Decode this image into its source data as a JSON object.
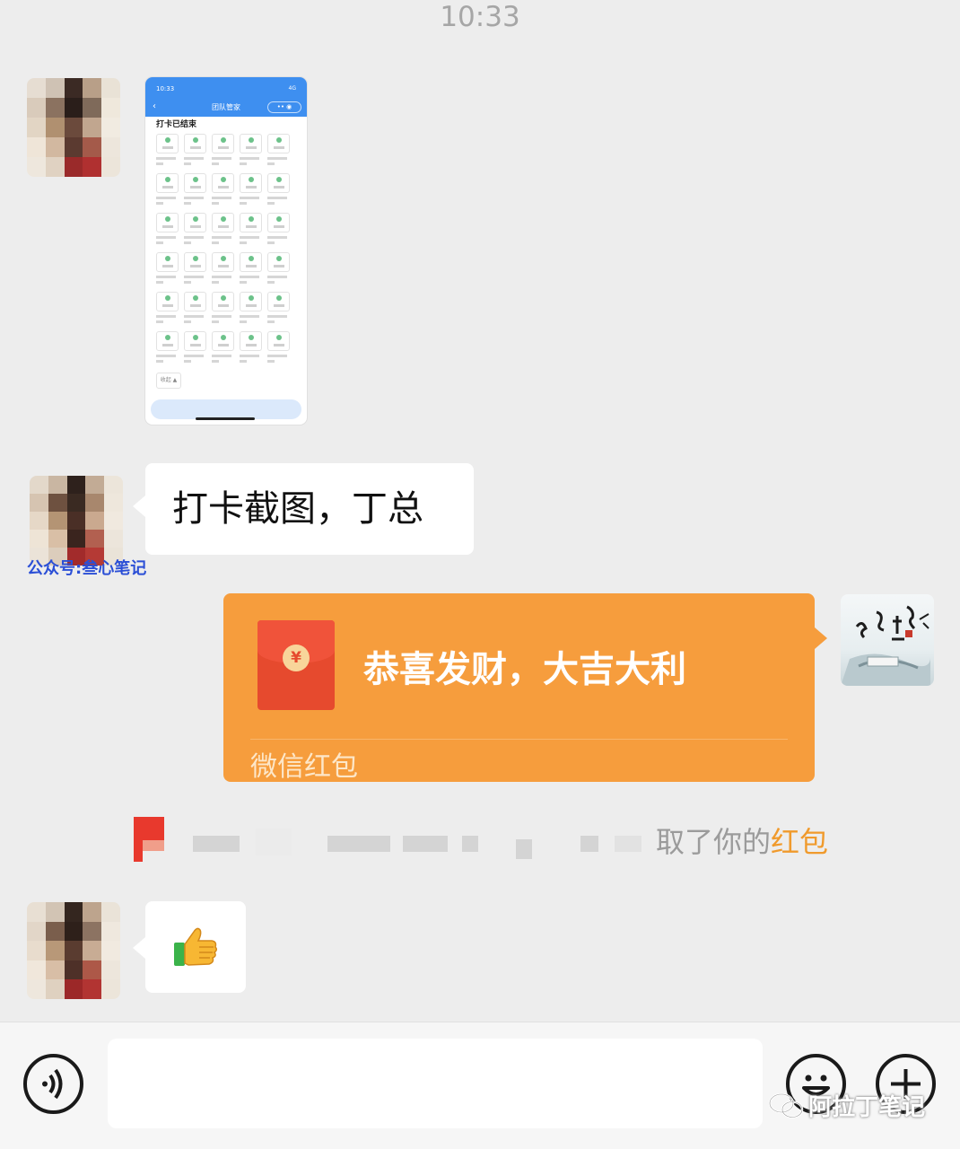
{
  "status": {
    "time": "10:33"
  },
  "chat": {
    "shared_screenshot": {
      "time": "10:33",
      "signal": "4G",
      "title": "团队管家",
      "status_text": "打卡已结束",
      "collapse_label": "收起"
    },
    "message_text": "打卡截图，丁总",
    "watermark": "公众号:叁心笔记",
    "red_packet": {
      "greeting": "恭喜发财，大吉大利",
      "label": "微信红包",
      "symbol": "¥"
    },
    "notice": {
      "text": "取了你的",
      "link": "红包"
    },
    "reply_emoji": "thumbs-up"
  },
  "input": {
    "placeholder": ""
  },
  "corner_watermark": "阿拉丁笔记",
  "colors": {
    "bg": "#ededed",
    "red_packet": "#f69d3d",
    "watermark_blue": "#2b4fd6"
  }
}
